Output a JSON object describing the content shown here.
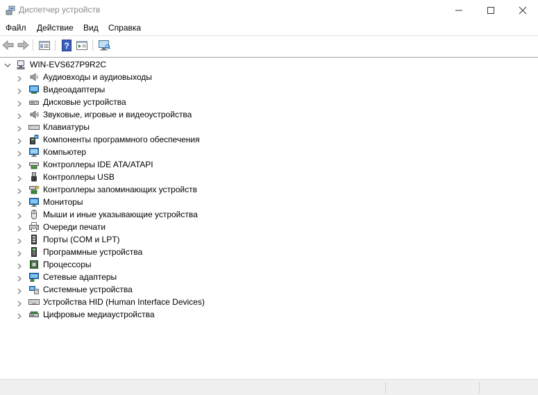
{
  "window": {
    "title": "Диспетчер устройств"
  },
  "menu": {
    "items": [
      "Файл",
      "Действие",
      "Вид",
      "Справка"
    ]
  },
  "toolbar": {
    "buttons": [
      "back-icon",
      "forward-icon",
      "properties-pane-icon",
      "help-icon",
      "update-driver-icon",
      "scan-hardware-icon"
    ]
  },
  "tree": {
    "root": "WIN-EVS627P9R2C",
    "items": [
      {
        "label": "Аудиовходы и аудиовыходы",
        "icon": "speaker-icon"
      },
      {
        "label": "Видеоадаптеры",
        "icon": "display-adapter-icon"
      },
      {
        "label": "Дисковые устройства",
        "icon": "disk-drive-icon"
      },
      {
        "label": "Звуковые, игровые и видеоустройства",
        "icon": "sound-icon"
      },
      {
        "label": "Клавиатуры",
        "icon": "keyboard-icon"
      },
      {
        "label": "Компоненты программного обеспечения",
        "icon": "software-component-icon"
      },
      {
        "label": "Компьютер",
        "icon": "computer-icon"
      },
      {
        "label": "Контроллеры IDE ATA/ATAPI",
        "icon": "ide-controller-icon"
      },
      {
        "label": "Контроллеры USB",
        "icon": "usb-icon"
      },
      {
        "label": "Контроллеры запоминающих устройств",
        "icon": "storage-controller-icon"
      },
      {
        "label": "Мониторы",
        "icon": "monitor-icon"
      },
      {
        "label": "Мыши и иные указывающие устройства",
        "icon": "mouse-icon"
      },
      {
        "label": "Очереди печати",
        "icon": "printer-icon"
      },
      {
        "label": "Порты (COM и LPT)",
        "icon": "port-icon"
      },
      {
        "label": "Программные устройства",
        "icon": "software-device-icon"
      },
      {
        "label": "Процессоры",
        "icon": "processor-icon"
      },
      {
        "label": "Сетевые адаптеры",
        "icon": "network-adapter-icon"
      },
      {
        "label": "Системные устройства",
        "icon": "system-device-icon"
      },
      {
        "label": "Устройства HID (Human Interface Devices)",
        "icon": "hid-icon"
      },
      {
        "label": "Цифровые медиаустройства",
        "icon": "media-device-icon"
      }
    ]
  },
  "colors": {
    "accent": "#2b7cd3",
    "chevron": "#7a7a7a",
    "title_text": "#8a8a8a"
  }
}
